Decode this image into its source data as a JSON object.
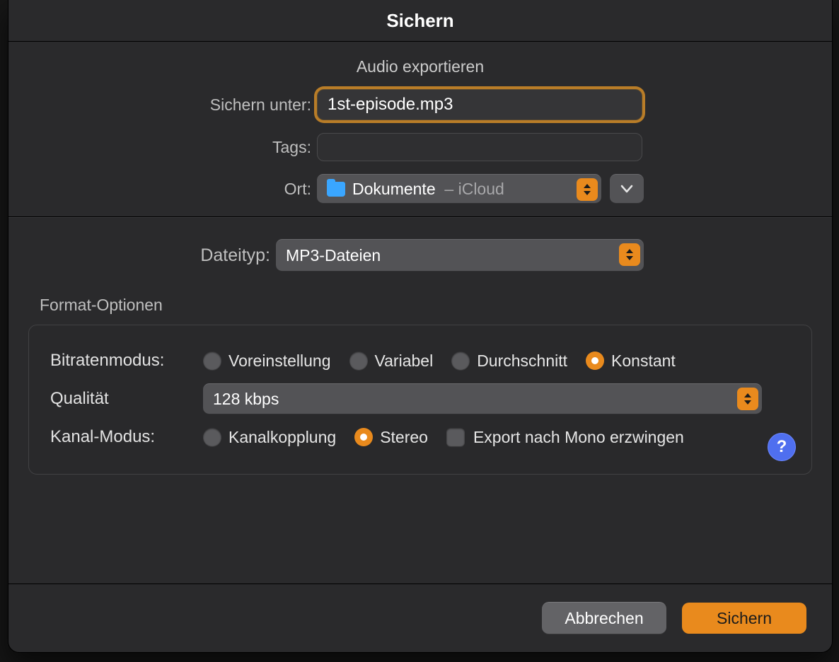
{
  "window": {
    "title": "Sichern"
  },
  "header": {
    "subtitle": "Audio exportieren"
  },
  "form": {
    "saveAs": {
      "label": "Sichern unter:",
      "value": "1st-episode.mp3"
    },
    "tags": {
      "label": "Tags:",
      "value": ""
    },
    "location": {
      "label": "Ort:",
      "folder": "Dokumente",
      "suffix": "iCloud",
      "separator": "–"
    }
  },
  "filetype": {
    "label": "Dateityp:",
    "value": "MP3-Dateien"
  },
  "group": {
    "title": "Format-Optionen",
    "bitrateMode": {
      "label": "Bitratenmodus:",
      "options": [
        "Voreinstellung",
        "Variabel",
        "Durchschnitt",
        "Konstant"
      ],
      "selectedIndex": 3
    },
    "quality": {
      "label": "Qualität",
      "value": "128 kbps"
    },
    "channelMode": {
      "label": "Kanal-Modus:",
      "options": [
        "Kanalkopplung",
        "Stereo"
      ],
      "selectedIndex": 1,
      "forceMonoLabel": "Export nach Mono erzwingen",
      "forceMono": false
    }
  },
  "footer": {
    "cancel": "Abbrechen",
    "confirm": "Sichern"
  },
  "help": "?"
}
